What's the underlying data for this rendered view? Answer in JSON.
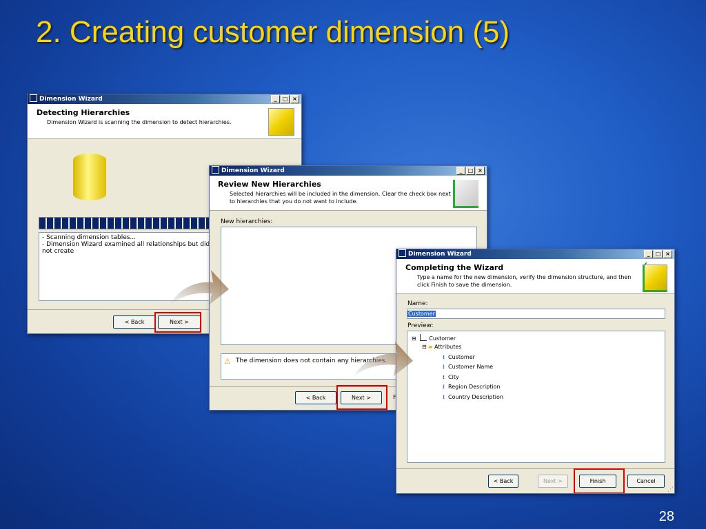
{
  "slide": {
    "title": "2. Creating customer dimension (5)",
    "page_number": "28"
  },
  "window1": {
    "title": "Dimension Wizard",
    "header_title": "Detecting Hierarchies",
    "header_desc": "Dimension Wizard is scanning the dimension to detect hierarchies.",
    "log_lines": [
      "- Scanning dimension tables...",
      "- Dimension Wizard examined all relationships but did not create"
    ],
    "back_label": "< Back",
    "next_label": "Next >"
  },
  "window2": {
    "title": "Dimension Wizard",
    "header_title": "Review New Hierarchies",
    "header_desc_1": "Selected hierarchies will be included in the dimension. Clear the check box next",
    "header_desc_2": "to hierarchies that you do not want to include.",
    "list_label": "New hierarchies:",
    "warning_text": "The dimension does not contain any hierarchies.",
    "back_label": "< Back",
    "next_label": "Next >",
    "finish_partial": "F"
  },
  "window3": {
    "title": "Dimension Wizard",
    "header_title": "Completing the Wizard",
    "header_desc_1": "Type a name for the new dimension, verify the dimension structure, and then",
    "header_desc_2": "click Finish to save the dimension.",
    "name_label": "Name:",
    "name_value": "Customer",
    "preview_label": "Preview:",
    "tree": {
      "root": "Customer",
      "folder": "Attributes",
      "attributes": [
        "Customer",
        "Customer Name",
        "City",
        "Region Description",
        "Country Description"
      ]
    },
    "back_label": "< Back",
    "next_label": "Next >",
    "finish_label": "Finish",
    "cancel_label": "Cancel"
  },
  "colors": {
    "title_yellow": "#ffd600",
    "highlight_red": "#e00000"
  }
}
